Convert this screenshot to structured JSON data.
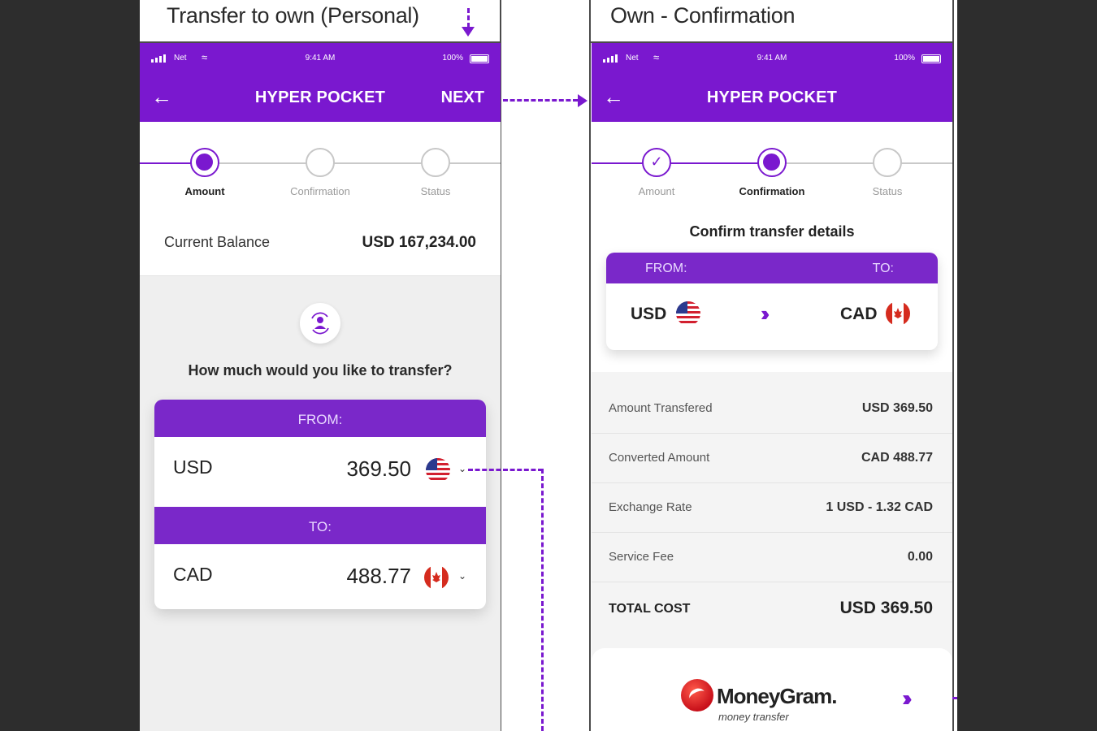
{
  "screens": {
    "left": {
      "caption": "Transfer to own (Personal)",
      "status": {
        "net": "Net",
        "time": "9:41 AM",
        "battery": "100%"
      },
      "header": {
        "title": "HYPER POCKET",
        "next_label": "NEXT"
      },
      "steps": [
        "Amount",
        "Confirmation",
        "Status"
      ],
      "current_step": 0,
      "balance": {
        "label": "Current Balance",
        "value": "USD 167,234.00"
      },
      "question": "How much would you like to transfer?",
      "from": {
        "label": "FROM:",
        "currency": "USD",
        "amount": "369.50",
        "flag": "us-flag-icon"
      },
      "to": {
        "label": "TO:",
        "currency": "CAD",
        "amount": "488.77",
        "flag": "ca-flag-icon"
      }
    },
    "right": {
      "caption": "Own - Confirmation",
      "status": {
        "net": "Net",
        "time": "9:41 AM",
        "battery": "100%"
      },
      "header": {
        "title": "HYPER POCKET"
      },
      "steps": [
        "Amount",
        "Confirmation",
        "Status"
      ],
      "current_step": 1,
      "confirm_title": "Confirm transfer details",
      "from": {
        "label": "FROM:",
        "currency": "USD"
      },
      "to": {
        "label": "TO:",
        "currency": "CAD"
      },
      "details": [
        {
          "label": "Amount Transfered",
          "value": "USD 369.50"
        },
        {
          "label": "Converted Amount",
          "value": "CAD 488.77"
        },
        {
          "label": "Exchange Rate",
          "value": "1 USD - 1.32 CAD"
        },
        {
          "label": "Service Fee",
          "value": "0.00"
        }
      ],
      "total": {
        "label": "TOTAL COST",
        "value": "USD 369.50"
      },
      "provider": {
        "name": "MoneyGram.",
        "tagline": "money transfer"
      }
    }
  },
  "colors": {
    "brand": "#7a18cf",
    "brand_bar": "#7a28c9",
    "background": "#2d2d2d"
  }
}
